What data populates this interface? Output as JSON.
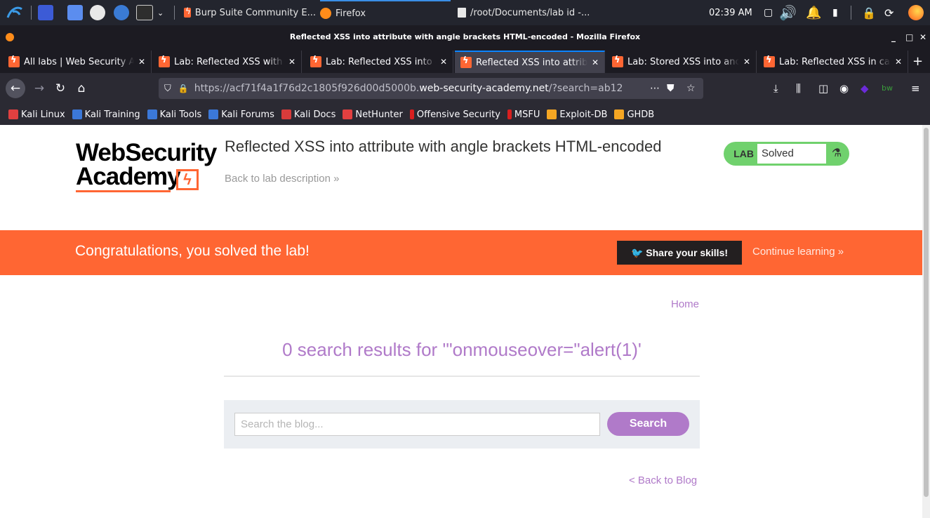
{
  "taskbar": {
    "tasks": [
      {
        "label": "Burp Suite Community E..."
      },
      {
        "label": "Firefox"
      },
      {
        "label": "/root/Documents/lab id -..."
      }
    ],
    "clock": "02:39 AM"
  },
  "window": {
    "title": "Reflected XSS into attribute with angle brackets HTML-encoded - Mozilla Firefox"
  },
  "tabs": [
    {
      "label": "All labs | Web Security Academy"
    },
    {
      "label": "Lab: Reflected XSS with some"
    },
    {
      "label": "Lab: Reflected XSS into a"
    },
    {
      "label": "Reflected XSS into attribute"
    },
    {
      "label": "Lab: Stored XSS into anchor"
    },
    {
      "label": "Lab: Reflected XSS in canonical"
    }
  ],
  "urlbar": {
    "prefix": "https://acf71f4a1f76d2c1805f926d00d5000b.",
    "domain": "web-security-academy.net",
    "path": "/?search=ab12"
  },
  "bookmarks": [
    {
      "label": "Kali Linux",
      "color": "#e24040"
    },
    {
      "label": "Kali Training",
      "color": "#3b78d8"
    },
    {
      "label": "Kali Tools",
      "color": "#3b78d8"
    },
    {
      "label": "Kali Forums",
      "color": "#3b78d8"
    },
    {
      "label": "Kali Docs",
      "color": "#d83b3b"
    },
    {
      "label": "NetHunter",
      "color": "#e24040"
    },
    {
      "label": "Offensive Security",
      "color": "#d81f1f"
    },
    {
      "label": "MSFU",
      "color": "#d81f1f"
    },
    {
      "label": "Exploit-DB",
      "color": "#f5a623"
    },
    {
      "label": "GHDB",
      "color": "#f5a623"
    }
  ],
  "page": {
    "logo_line1": "WebSecurity",
    "logo_line2": "Academy",
    "lab_title": "Reflected XSS into attribute with angle brackets HTML-encoded",
    "back_to_description": "Back to lab description",
    "lab_tag": "LAB",
    "lab_status": "Solved",
    "banner_text": "Congratulations, you solved the lab!",
    "share_button": "Share your skills!",
    "continue_learning": "Continue learning",
    "home_link": "Home",
    "results_title": "0 search results for '\"onmouseover=\"alert(1)'",
    "search_placeholder": "Search the blog...",
    "search_button": "Search",
    "back_to_blog": "< Back to Blog",
    "accent_color": "#ff6633",
    "link_color": "#b07ac9"
  }
}
